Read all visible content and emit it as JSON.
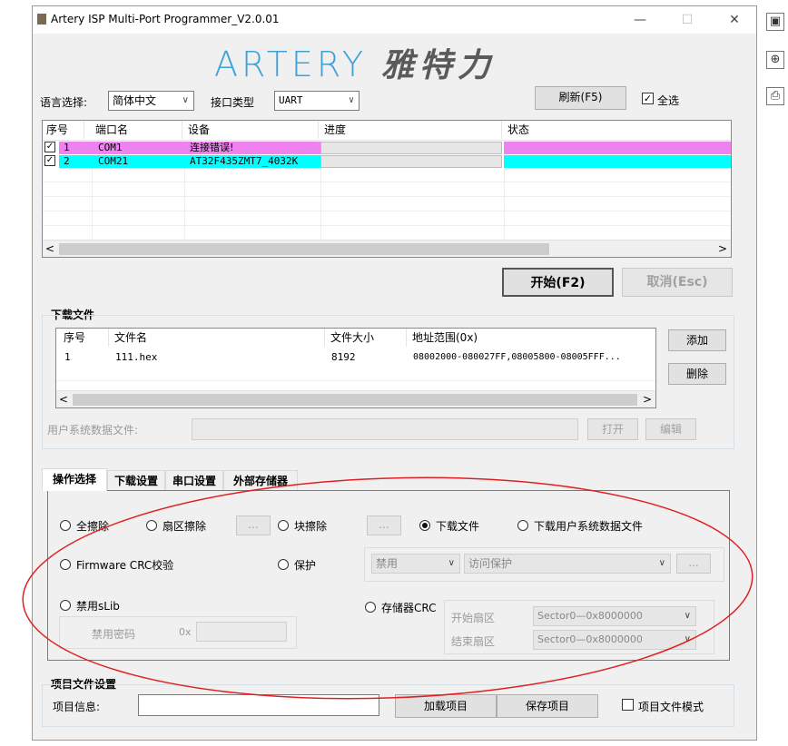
{
  "window": {
    "title": "Artery ISP Multi-Port Programmer_V2.0.01",
    "minimize_glyph": "—",
    "maximize_glyph": "☐",
    "close_glyph": "✕"
  },
  "logo": {
    "en": "ARTERY",
    "cn": "雅特力"
  },
  "top": {
    "lang_label": "语言选择:",
    "lang_value": "简体中文",
    "iface_label": "接口类型",
    "iface_value": "UART",
    "refresh_label": "刷新(F5)",
    "select_all_label": "全选",
    "select_all_checked": true
  },
  "ports": {
    "columns": [
      "序号",
      "端口名",
      "设备",
      "进度",
      "状态"
    ],
    "rows": [
      {
        "checked": true,
        "index": "1",
        "port": "COM1",
        "device": "连接错误!",
        "progress": 0,
        "color": "#ee82ee"
      },
      {
        "checked": true,
        "index": "2",
        "port": "COM21",
        "device": "AT32F435ZMT7_4032K",
        "progress": 0,
        "color": "#00ffff"
      }
    ]
  },
  "actions": {
    "start_label": "开始(F2)",
    "cancel_label": "取消(Esc)"
  },
  "download": {
    "group_title": "下载文件",
    "columns": [
      "序号",
      "文件名",
      "文件大小",
      "地址范围(0x)"
    ],
    "rows": [
      {
        "index": "1",
        "name": "111.hex",
        "size": "8192",
        "range": "08002000-080027FF,08005800-08005FFF..."
      }
    ],
    "add_label": "添加",
    "delete_label": "删除",
    "user_data_label": "用户系统数据文件:",
    "open_label": "打开",
    "edit_label": "编辑"
  },
  "tabs": [
    "操作选择",
    "下载设置",
    "串口设置",
    "外部存储器"
  ],
  "ops": {
    "full_erase": "全擦除",
    "sector_erase": "扇区擦除",
    "block_erase": "块擦除",
    "download_file": "下载文件",
    "download_user_data": "下载用户系统数据文件",
    "firmware_crc": "Firmware CRC校验",
    "protect": "保护",
    "protect_disable": "禁用",
    "protect_access": "访问保护",
    "disable_slib": "禁用sLib",
    "disable_pwd": "禁用密码",
    "hex_prefix": "0x",
    "memory_crc": "存储器CRC",
    "start_sector_label": "开始扇区",
    "start_sector_value": "Sector0—0x8000000",
    "end_sector_label": "结束扇区",
    "end_sector_value": "Sector0—0x8000000",
    "ellipsis": "...",
    "selected": "download_file"
  },
  "project": {
    "group_title": "项目文件设置",
    "info_label": "项目信息:",
    "info_value": "",
    "load_label": "加载项目",
    "save_label": "保存项目",
    "mode_label": "项目文件模式",
    "mode_checked": false
  },
  "side_icons": [
    "image-icon",
    "zoom-in-icon",
    "print-icon"
  ],
  "annotation": {
    "color": "#e02020"
  }
}
